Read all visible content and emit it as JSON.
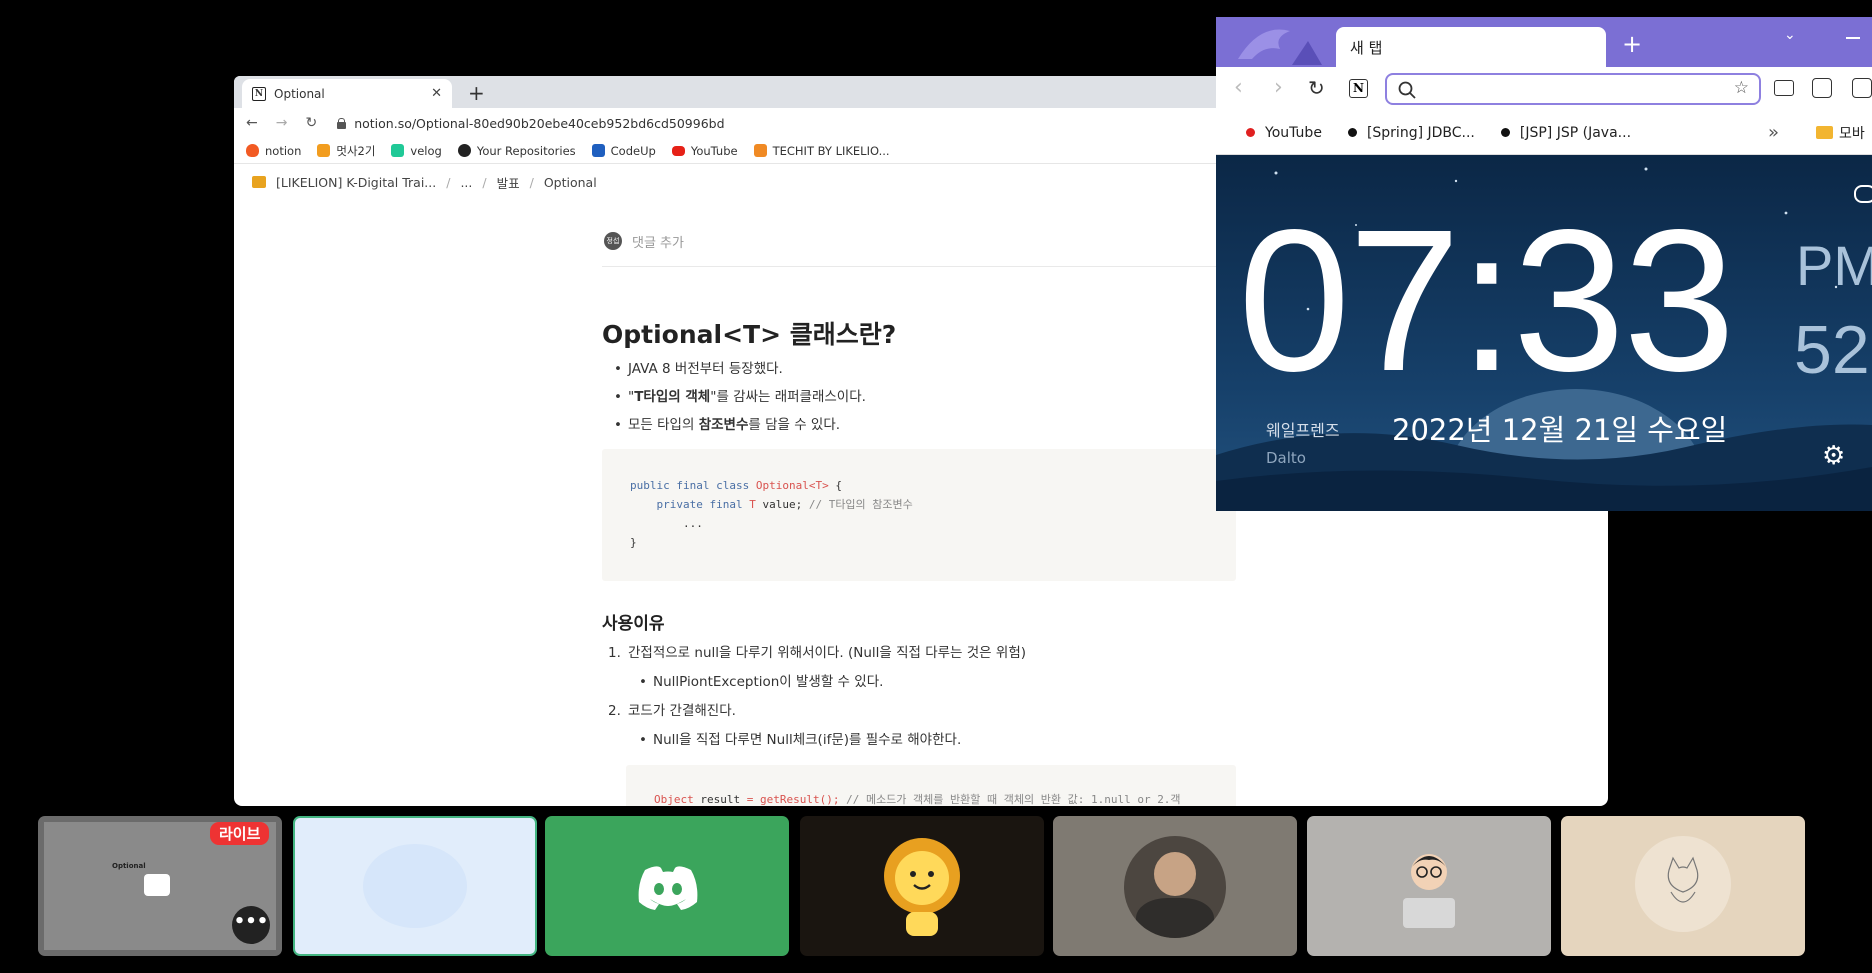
{
  "notion_window": {
    "tab_title": "Optional",
    "url": "notion.so/Optional-80ed90b20ebe40ceb952bd6cd50996bd",
    "bookmarks": [
      "notion",
      "멋사2기",
      "velog",
      "Your Repositories",
      "CodeUp",
      "YouTube",
      "TECHIT BY LIKELIO..."
    ],
    "breadcrumb": [
      "[LIKELION] K-Digital Trai...",
      "...",
      "발표",
      "Optional"
    ],
    "comment_avatar": "정섭",
    "add_comment": "댓글 추가",
    "heading": "Optional<T> 클래스란?",
    "bullets": [
      {
        "pre": "JAVA 8 버전부터 등장했다.",
        "bold": "",
        "post": ""
      },
      {
        "pre": "\"",
        "bold": "T타입의 객체",
        "post": "\"를 감싸는 래퍼클래스이다."
      },
      {
        "pre": "모든 타입의 ",
        "bold": "참조변수",
        "post": "를 담을 수 있다."
      }
    ],
    "code1": {
      "line1_kw": "public final class",
      "line1_cls": "Optional<T>",
      "line1_end": " {",
      "line2_kw": "private final",
      "line2_type": "T",
      "line2_rest": " value;",
      "line2_cm": " // T타입의 참조변수",
      "line3": "...",
      "line4": "}"
    },
    "subheading": "사용이유",
    "reasons": [
      {
        "num": "1.",
        "text": "간접적으로 null을 다루기 위해서이다. (Null을 직접 다루는 것은 위험)",
        "sub": "NullPiontException이 발생할 수 있다."
      },
      {
        "num": "2.",
        "text": "코드가 간결해진다.",
        "sub": "Null을 직접 다루면 Null체크(if문)를 필수로 해야한다."
      }
    ],
    "code2": {
      "type": "Object",
      "rest": " result ",
      "eq": "=",
      "call": " getResult();",
      "cm": " // 메소드가 객체를 반환할 때 객체의 반환 값: 1.null or 2.객"
    }
  },
  "whale_window": {
    "tab_title": "새 탭",
    "bookmarks": [
      "YouTube",
      "[Spring] JDBC...",
      "[JSP] JSP (Java..."
    ],
    "bookmark_overflow": "»",
    "folder_label": "모바",
    "time": "07:33",
    "ampm": "PM",
    "seconds": "52",
    "date": "2022년 12월 21일 수요일",
    "friends_label": "웨일프렌즈",
    "friend_name": "Dalto"
  },
  "strip": {
    "live_badge": "라이브",
    "mini_title": "Optional"
  },
  "colors": {
    "whale_accent": "#7b6fd4",
    "night_sky": "#0d2a49",
    "discord_green": "#3ba55c",
    "selected_border": "#43b581",
    "live_red": "#e33333"
  }
}
